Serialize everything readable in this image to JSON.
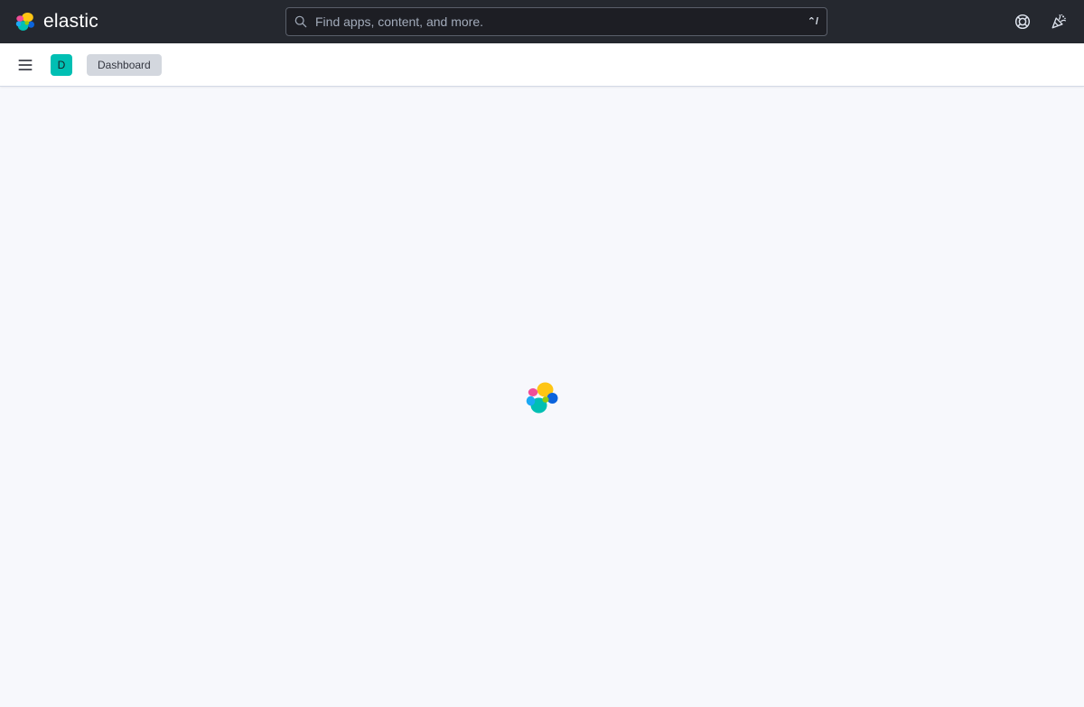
{
  "header": {
    "brand_name": "elastic",
    "logo_icon": "elastic-logo-icon",
    "search": {
      "placeholder": "Find apps, content, and more.",
      "value": "",
      "shortcut": "⌃/"
    },
    "help_icon": "help-icon",
    "news_icon": "newsfeed-icon"
  },
  "subheader": {
    "menu_icon": "hamburger-menu-icon",
    "space_initial": "D",
    "breadcrumbs": [
      {
        "label": "Dashboard"
      }
    ]
  },
  "main": {
    "state": "loading",
    "loader_icon": "elastic-logo-loading-icon"
  },
  "colors": {
    "header_bg": "#25282f",
    "subheader_bg": "#ffffff",
    "page_bg": "#f7f8fc",
    "space_avatar": "#00bfb3",
    "logo_yellow": "#fec514",
    "logo_pink": "#f04e98",
    "logo_teal": "#00bfb3",
    "logo_blue": "#1ba9f5",
    "logo_darkblue": "#0b64dd",
    "logo_green": "#93c90e"
  }
}
